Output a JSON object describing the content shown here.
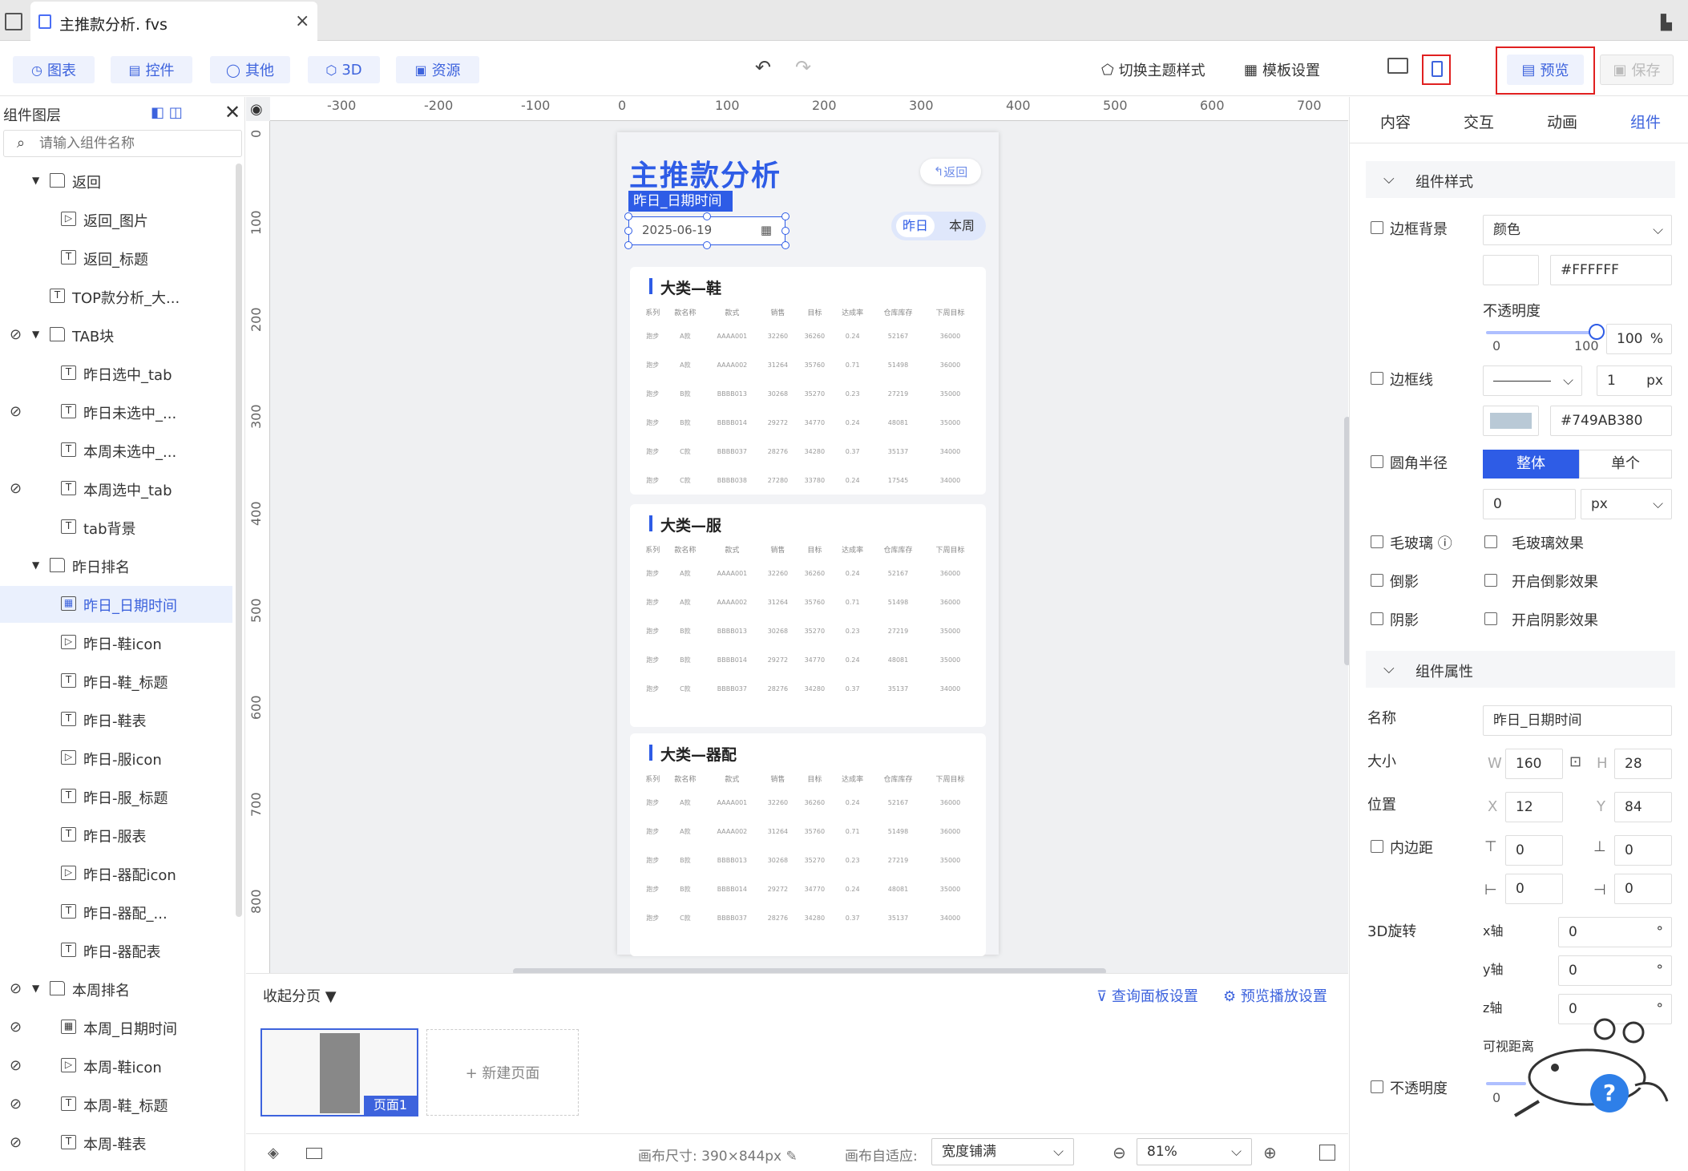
{
  "window": {
    "tab_title": "主推款分析. fvs",
    "close": "×"
  },
  "toolbar": {
    "chart": "图表",
    "control": "控件",
    "other": "其他",
    "threeD": "3D",
    "resource": "资源",
    "switch_theme": "切换主题样式",
    "template_settings": "模板设置",
    "preview": "预览",
    "save": "保存"
  },
  "layers": {
    "title": "组件图层",
    "search_placeholder": "请输入组件名称",
    "items": [
      {
        "name": "返回",
        "type": "folder",
        "level": 1,
        "expanded": true,
        "hidden": false
      },
      {
        "name": "返回_图片",
        "type": "image",
        "level": 2,
        "hidden": false
      },
      {
        "name": "返回_标题",
        "type": "text",
        "level": 2,
        "hidden": false
      },
      {
        "name": "TOP款分析_大...",
        "type": "text",
        "level": 1,
        "hidden": false
      },
      {
        "name": "TAB块",
        "type": "folder",
        "level": 1,
        "expanded": true,
        "hidden": true
      },
      {
        "name": "昨日选中_tab",
        "type": "text",
        "level": 2,
        "hidden": false
      },
      {
        "name": "昨日未选中_...",
        "type": "text",
        "level": 2,
        "hidden": true
      },
      {
        "name": "本周未选中_...",
        "type": "text",
        "level": 2,
        "hidden": false
      },
      {
        "name": "本周选中_tab",
        "type": "text",
        "level": 2,
        "hidden": true
      },
      {
        "name": "tab背景",
        "type": "text",
        "level": 2,
        "hidden": false
      },
      {
        "name": "昨日排名",
        "type": "folder",
        "level": 1,
        "expanded": true,
        "hidden": false
      },
      {
        "name": "昨日_日期时间",
        "type": "date",
        "level": 2,
        "hidden": false,
        "selected": true
      },
      {
        "name": "昨日-鞋icon",
        "type": "image",
        "level": 2,
        "hidden": false
      },
      {
        "name": "昨日-鞋_标题",
        "type": "text",
        "level": 2,
        "hidden": false
      },
      {
        "name": "昨日-鞋表",
        "type": "text",
        "level": 2,
        "hidden": false
      },
      {
        "name": "昨日-服icon",
        "type": "image",
        "level": 2,
        "hidden": false
      },
      {
        "name": "昨日-服_标题",
        "type": "text",
        "level": 2,
        "hidden": false
      },
      {
        "name": "昨日-服表",
        "type": "text",
        "level": 2,
        "hidden": false
      },
      {
        "name": "昨日-器配icon",
        "type": "image",
        "level": 2,
        "hidden": false
      },
      {
        "name": "昨日-器配_...",
        "type": "text",
        "level": 2,
        "hidden": false
      },
      {
        "name": "昨日-器配表",
        "type": "text",
        "level": 2,
        "hidden": false
      },
      {
        "name": "本周排名",
        "type": "folder",
        "level": 1,
        "expanded": true,
        "hidden": true
      },
      {
        "name": "本周_日期时间",
        "type": "date",
        "level": 2,
        "hidden": true
      },
      {
        "name": "本周-鞋icon",
        "type": "image",
        "level": 2,
        "hidden": true
      },
      {
        "name": "本周-鞋_标题",
        "type": "text",
        "level": 2,
        "hidden": true
      },
      {
        "name": "本周-鞋表",
        "type": "text",
        "level": 2,
        "hidden": true
      }
    ]
  },
  "ruler": {
    "top": [
      "-300",
      "-200",
      "-100",
      "0",
      "100",
      "200",
      "300",
      "400",
      "500",
      "600",
      "700"
    ],
    "left": [
      "0",
      "100",
      "200",
      "300",
      "400",
      "500",
      "600",
      "700",
      "800"
    ]
  },
  "phone": {
    "title": "主推款分析",
    "back": "返回",
    "selected_tag": "昨日_日期时间",
    "date": "2025-06-19",
    "tab_yesterday": "昨日",
    "tab_week": "本周",
    "columns": [
      "系列",
      "款名称",
      "款式",
      "销售",
      "目标",
      "达成率",
      "仓库库存",
      "下周目标"
    ],
    "cards": [
      {
        "title": "大类—鞋",
        "rows": [
          [
            "跑步",
            "A款",
            "AAAA001",
            "32260",
            "36260",
            "0.24",
            "52167",
            "36000"
          ],
          [
            "跑步",
            "A款",
            "AAAA002",
            "31264",
            "35760",
            "0.71",
            "51498",
            "36000"
          ],
          [
            "跑步",
            "B款",
            "BBBB013",
            "30268",
            "35270",
            "0.23",
            "27219",
            "35000"
          ],
          [
            "跑步",
            "B款",
            "BBBB014",
            "29272",
            "34770",
            "0.24",
            "48081",
            "35000"
          ],
          [
            "跑步",
            "C款",
            "BBBB037",
            "28276",
            "34280",
            "0.37",
            "35137",
            "34000"
          ],
          [
            "跑步",
            "C款",
            "BBBB038",
            "27280",
            "33780",
            "0.24",
            "17545",
            "34000"
          ]
        ]
      },
      {
        "title": "大类—服",
        "rows": [
          [
            "跑步",
            "A款",
            "AAAA001",
            "32260",
            "36260",
            "0.24",
            "52167",
            "36000"
          ],
          [
            "跑步",
            "A款",
            "AAAA002",
            "31264",
            "35760",
            "0.71",
            "51498",
            "36000"
          ],
          [
            "跑步",
            "B款",
            "BBBB013",
            "30268",
            "35270",
            "0.23",
            "27219",
            "35000"
          ],
          [
            "跑步",
            "B款",
            "BBBB014",
            "29272",
            "34770",
            "0.24",
            "48081",
            "35000"
          ],
          [
            "跑步",
            "C款",
            "BBBB037",
            "28276",
            "34280",
            "0.37",
            "35137",
            "34000"
          ]
        ]
      },
      {
        "title": "大类—器配",
        "rows": [
          [
            "跑步",
            "A款",
            "AAAA001",
            "32260",
            "36260",
            "0.24",
            "52167",
            "36000"
          ],
          [
            "跑步",
            "A款",
            "AAAA002",
            "31264",
            "35760",
            "0.71",
            "51498",
            "36000"
          ],
          [
            "跑步",
            "B款",
            "BBBB013",
            "30268",
            "35270",
            "0.23",
            "27219",
            "35000"
          ],
          [
            "跑步",
            "B款",
            "BBBB014",
            "29272",
            "34770",
            "0.24",
            "48081",
            "35000"
          ],
          [
            "跑步",
            "C款",
            "BBBB037",
            "28276",
            "34280",
            "0.37",
            "35137",
            "34000"
          ]
        ]
      }
    ]
  },
  "pages": {
    "fold": "收起分页",
    "query_panel": "查询面板设置",
    "preview_play": "预览播放设置",
    "page1": "页面1",
    "new_page": "+ 新建页面"
  },
  "status": {
    "canvas_size": "画布尺寸: 390×844px",
    "fit_label": "画布自适应:",
    "fit_value": "宽度铺满",
    "zoom": "81%"
  },
  "props": {
    "tabs": [
      "内容",
      "交互",
      "动画",
      "组件"
    ],
    "active_tab": "组件",
    "style_section": "组件样式",
    "border_bg_label": "边框背景",
    "border_bg_type": "颜色",
    "bg_color": "#FFFFFF",
    "opacity_label": "不透明度",
    "opacity_min": "0",
    "opacity_max": "100",
    "opacity_value": "100",
    "percent": "%",
    "border_line_label": "边框线",
    "border_width": "1",
    "px": "px",
    "border_color": "#749AB380",
    "radius_label": "圆角半径",
    "radius_all": "整体",
    "radius_single": "单个",
    "radius_value": "0",
    "glass_label": "毛玻璃",
    "glass_effect": "毛玻璃效果",
    "reflect_label": "倒影",
    "reflect_effect": "开启倒影效果",
    "shadow_label": "阴影",
    "shadow_effect": "开启阴影效果",
    "attr_section": "组件属性",
    "name_label": "名称",
    "name_value": "昨日_日期时间",
    "size_label": "大小",
    "w_label": "W",
    "w_value": "160",
    "h_label": "H",
    "h_value": "28",
    "pos_label": "位置",
    "x_label": "X",
    "x_value": "12",
    "y_label": "Y",
    "y_value": "84",
    "padding_label": "内边距",
    "pad_top": "0",
    "pad_bottom": "0",
    "pad_left": "0",
    "pad_right": "0",
    "rot_label": "3D旋转",
    "x_axis": "x轴",
    "x_axis_value": "0",
    "y_axis": "y轴",
    "y_axis_value": "0",
    "z_axis": "z轴",
    "z_axis_value": "0",
    "view_dist": "可视距离",
    "deg": "°",
    "op_label": "不透明度",
    "op_min": "0"
  },
  "colors": {
    "accent": "#3d63dd",
    "brand_blue": "#2e5ce6",
    "highlight_red": "#e02020"
  }
}
